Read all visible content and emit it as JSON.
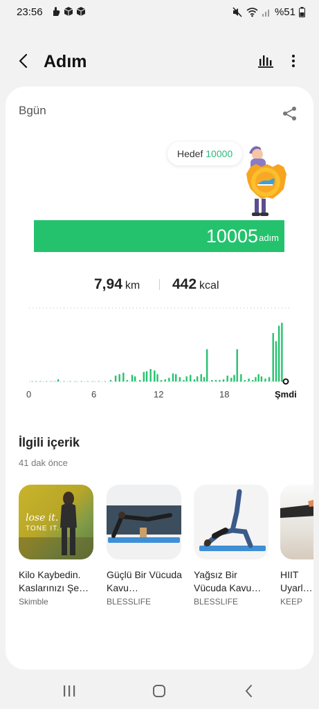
{
  "status": {
    "time": "23:56",
    "battery": "%51"
  },
  "header": {
    "title": "Adım"
  },
  "summary": {
    "date_label": "Bgün",
    "goal_label": "Hedef",
    "goal_value": "10000",
    "steps": "10005",
    "steps_unit": "adım",
    "distance": "7,94",
    "distance_unit": "km",
    "calories": "442",
    "calories_unit": "kcal"
  },
  "chart_data": {
    "type": "bar",
    "x_tick_labels": [
      "0",
      "6",
      "12",
      "18",
      "Şmdi"
    ],
    "x_ticks": [
      0,
      6,
      12,
      18,
      24
    ],
    "bar_color": "#24c26d",
    "bars": [
      {
        "x": 0.3,
        "v": 1
      },
      {
        "x": 0.7,
        "v": 1
      },
      {
        "x": 1.2,
        "v": 1
      },
      {
        "x": 1.8,
        "v": 1
      },
      {
        "x": 2.3,
        "v": 1
      },
      {
        "x": 2.7,
        "v": 1
      },
      {
        "x": 3.0,
        "v": 3
      },
      {
        "x": 3.6,
        "v": 1
      },
      {
        "x": 4.2,
        "v": 1
      },
      {
        "x": 4.8,
        "v": 1
      },
      {
        "x": 5.4,
        "v": 1
      },
      {
        "x": 6.0,
        "v": 1
      },
      {
        "x": 6.6,
        "v": 1
      },
      {
        "x": 7.2,
        "v": 1
      },
      {
        "x": 7.8,
        "v": 1
      },
      {
        "x": 8.4,
        "v": 2
      },
      {
        "x": 8.9,
        "v": 8
      },
      {
        "x": 9.3,
        "v": 10
      },
      {
        "x": 9.7,
        "v": 12
      },
      {
        "x": 10.1,
        "v": 2
      },
      {
        "x": 10.6,
        "v": 9
      },
      {
        "x": 10.9,
        "v": 7
      },
      {
        "x": 11.4,
        "v": 2
      },
      {
        "x": 11.8,
        "v": 13
      },
      {
        "x": 12.1,
        "v": 14
      },
      {
        "x": 12.5,
        "v": 17
      },
      {
        "x": 12.9,
        "v": 15
      },
      {
        "x": 13.2,
        "v": 10
      },
      {
        "x": 13.6,
        "v": 2
      },
      {
        "x": 14.0,
        "v": 3
      },
      {
        "x": 14.4,
        "v": 5
      },
      {
        "x": 14.8,
        "v": 11
      },
      {
        "x": 15.1,
        "v": 10
      },
      {
        "x": 15.5,
        "v": 6
      },
      {
        "x": 15.9,
        "v": 2
      },
      {
        "x": 16.2,
        "v": 7
      },
      {
        "x": 16.6,
        "v": 9
      },
      {
        "x": 17.0,
        "v": 3
      },
      {
        "x": 17.3,
        "v": 7
      },
      {
        "x": 17.7,
        "v": 10
      },
      {
        "x": 18.0,
        "v": 6
      },
      {
        "x": 18.3,
        "v": 44
      },
      {
        "x": 18.8,
        "v": 2
      },
      {
        "x": 19.2,
        "v": 2
      },
      {
        "x": 19.6,
        "v": 2
      },
      {
        "x": 20.0,
        "v": 3
      },
      {
        "x": 20.4,
        "v": 8
      },
      {
        "x": 20.8,
        "v": 5
      },
      {
        "x": 21.1,
        "v": 9
      },
      {
        "x": 21.4,
        "v": 44
      },
      {
        "x": 21.8,
        "v": 10
      },
      {
        "x": 22.2,
        "v": 2
      },
      {
        "x": 22.6,
        "v": 4
      },
      {
        "x": 23.0,
        "v": 2
      },
      {
        "x": 23.3,
        "v": 6
      },
      {
        "x": 23.6,
        "v": 10
      },
      {
        "x": 23.9,
        "v": 7
      },
      {
        "x": 24.3,
        "v": 4
      },
      {
        "x": 24.7,
        "v": 6
      },
      {
        "x": 25.1,
        "v": 66
      },
      {
        "x": 25.4,
        "v": 55
      },
      {
        "x": 25.7,
        "v": 76
      },
      {
        "x": 26.0,
        "v": 80
      }
    ],
    "x_range": [
      0,
      26.4
    ],
    "y_range": [
      0,
      100
    ]
  },
  "related": {
    "title": "İlgili içerik",
    "subtitle": "41 dak önce",
    "items": [
      {
        "title": "Kilo Kaybedin. Kaslarınızı Şe…",
        "source": "Skimble",
        "thumb_text_1": "lose it.",
        "thumb_text_2": "TONE IT."
      },
      {
        "title": "Güçlü Bir Vücuda Kavu…",
        "source": "BLESSLIFE"
      },
      {
        "title": "Yağsız Bir Vücuda Kavu…",
        "source": "BLESSLIFE"
      },
      {
        "title": "HIIT Uyarlan",
        "source": "KEEP"
      }
    ]
  },
  "colors": {
    "accent": "#24c26d",
    "goal_text": "#2db87a"
  }
}
